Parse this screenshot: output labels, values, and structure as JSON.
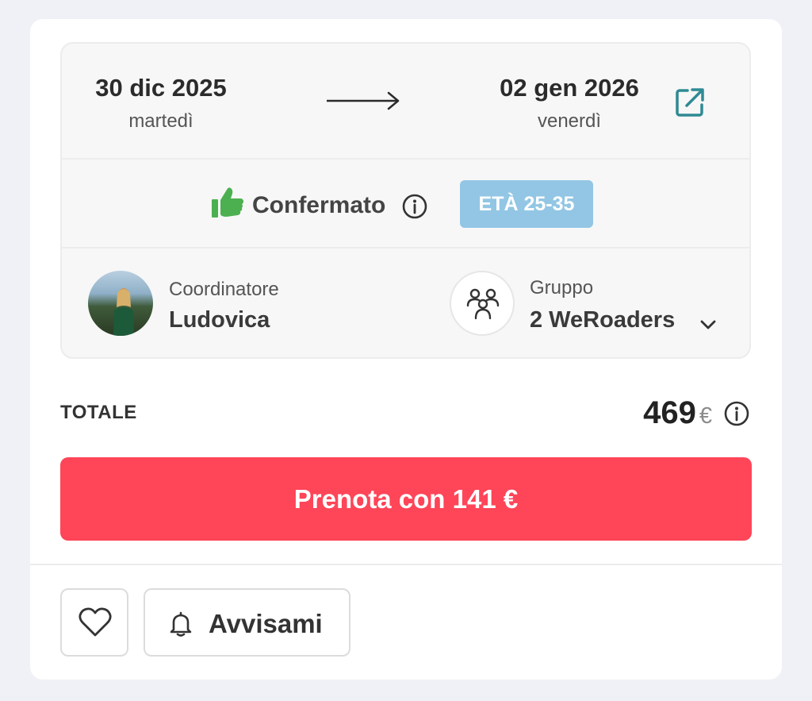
{
  "dates": {
    "start_date": "30 dic 2025",
    "start_day": "martedì",
    "end_date": "02 gen 2026",
    "end_day": "venerdì"
  },
  "status": {
    "label": "Confermato",
    "age_badge": "ETÀ 25-35"
  },
  "coordinator": {
    "label": "Coordinatore",
    "name": "Ludovica"
  },
  "group": {
    "label": "Gruppo",
    "value": "2 WeRoaders"
  },
  "total": {
    "label": "TOTALE",
    "amount": "469",
    "currency": "€"
  },
  "book_button": "Prenota con 141 €",
  "notify_button": "Avvisami",
  "colors": {
    "book": "#ff4558",
    "badge": "#92c6e4",
    "confirm_green": "#4cb050",
    "link_teal": "#2f8a94"
  },
  "icons": [
    "external-link-icon",
    "thumbs-up-icon",
    "info-icon",
    "group-icon",
    "chevron-down-icon",
    "heart-icon",
    "bell-icon"
  ]
}
